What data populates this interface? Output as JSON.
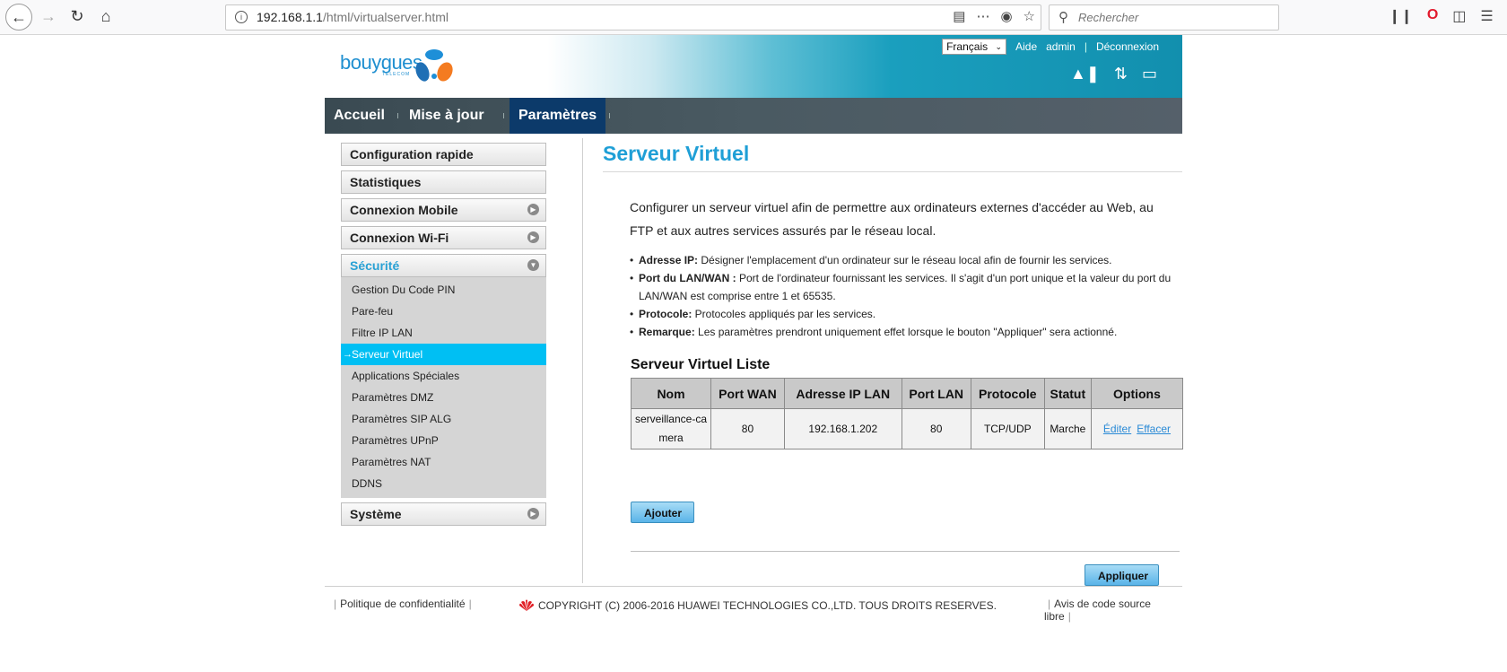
{
  "browser": {
    "url_host": "192.168.1.1",
    "url_path": "/html/virtualserver.html",
    "search_placeholder": "Rechercher"
  },
  "header": {
    "logo_text": "bouygues",
    "logo_sub": "TELECOM",
    "language": "Français",
    "help": "Aide",
    "user": "admin",
    "logout": "Déconnexion"
  },
  "nav": {
    "items": [
      {
        "label": "Accueil"
      },
      {
        "label": "Mise à jour"
      },
      {
        "label": "Paramètres"
      }
    ]
  },
  "sidebar": {
    "groups": [
      {
        "label": "Configuration rapide"
      },
      {
        "label": "Statistiques"
      },
      {
        "label": "Connexion Mobile"
      },
      {
        "label": "Connexion Wi-Fi"
      },
      {
        "label": "Sécurité"
      },
      {
        "label": "Système"
      }
    ],
    "security_items": [
      {
        "label": "Gestion Du Code PIN"
      },
      {
        "label": "Pare-feu"
      },
      {
        "label": "Filtre IP LAN"
      },
      {
        "label": "Serveur Virtuel"
      },
      {
        "label": "Applications Spéciales"
      },
      {
        "label": "Paramètres DMZ"
      },
      {
        "label": "Paramètres SIP ALG"
      },
      {
        "label": "Paramètres UPnP"
      },
      {
        "label": "Paramètres NAT"
      },
      {
        "label": "DDNS"
      }
    ]
  },
  "content": {
    "title": "Serveur Virtuel",
    "intro": "Configurer un serveur virtuel afin de permettre aux ordinateurs externes d'accéder au Web, au FTP et aux autres services assurés par le réseau local.",
    "bullets": [
      {
        "term": "Adresse IP:",
        "text": " Désigner l'emplacement d'un ordinateur sur le réseau local afin de fournir les services."
      },
      {
        "term": "Port du LAN/WAN :",
        "text": " Port de l'ordinateur fournissant les services. Il s'agit d'un port unique et la valeur du port du LAN/WAN est comprise entre 1 et 65535."
      },
      {
        "term": "Protocole:",
        "text": " Protocoles appliqués par les services."
      },
      {
        "term": "Remarque:",
        "text": " Les paramètres prendront uniquement effet lorsque le bouton \"Appliquer\" sera actionné."
      }
    ],
    "list_title": "Serveur Virtuel Liste",
    "columns": [
      "Nom",
      "Port WAN",
      "Adresse IP LAN",
      "Port LAN",
      "Protocole",
      "Statut",
      "Options"
    ],
    "rows": [
      {
        "nom": "serveillance-camera",
        "port_wan": "80",
        "ip_lan": "192.168.1.202",
        "port_lan": "80",
        "protocole": "TCP/UDP",
        "statut": "Marche",
        "edit": "Éditer",
        "delete": "Effacer"
      }
    ],
    "add_label": "Ajouter",
    "apply_label": "Appliquer"
  },
  "footer": {
    "privacy": "Politique de confidentialité",
    "copyright": "COPYRIGHT (C) 2006-2016 HUAWEI TECHNOLOGIES CO.,LTD. TOUS DROITS RESERVES.",
    "opensource": "Avis de code source libre"
  },
  "colors": {
    "accent": "#1f9fd6",
    "nav_active": "#0c3a6a",
    "submenu_active": "#00bff3"
  }
}
